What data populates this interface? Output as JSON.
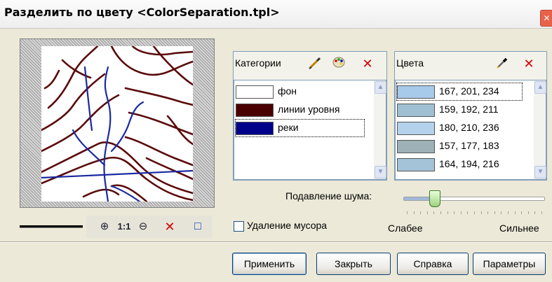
{
  "window": {
    "title": "Разделить по цвету <ColorSeparation.tpl>",
    "close_glyph": "✕"
  },
  "zoom_tools": {
    "zoom_in": "⊕",
    "one_to_one": "1:1",
    "zoom_out": "⊖",
    "clear": "✕",
    "fit": "□"
  },
  "categories": {
    "title": "Категории",
    "tool_icons": [
      "eyedropper-pencil-icon",
      "palette-icon",
      "delete-icon"
    ],
    "delete_glyph": "✕",
    "items": [
      {
        "label": "фон",
        "color": "#ffffff"
      },
      {
        "label": "линии уровня",
        "color": "#4a0000"
      },
      {
        "label": "реки",
        "color": "#00008b"
      }
    ],
    "selected_index": 2
  },
  "colors": {
    "title": "Цвета",
    "delete_glyph": "✕",
    "items": [
      {
        "text": "167,  201,  234",
        "color": "#a7c9ea"
      },
      {
        "text": "159,  192,  211",
        "color": "#9fc0d3"
      },
      {
        "text": "180,  210,  236",
        "color": "#b4d2ec"
      },
      {
        "text": "157,  177,  183",
        "color": "#9db1b7"
      },
      {
        "text": "164,  194,  216",
        "color": "#a4c2d8"
      }
    ],
    "selected_index": 0
  },
  "noise": {
    "label": "Подавление шума:",
    "weak": "Слабее",
    "strong": "Сильнее",
    "level": 0.22
  },
  "trash": {
    "label": "Удаление мусора",
    "checked": false
  },
  "buttons": {
    "apply": "Применить",
    "close": "Закрыть",
    "help": "Справка",
    "params": "Параметры"
  },
  "palette": {
    "contour": "#5a0a0a",
    "river": "#1a2aa0",
    "accent": "#003c74"
  }
}
